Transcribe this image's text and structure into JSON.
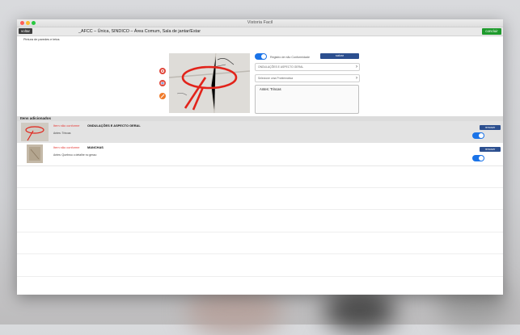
{
  "window": {
    "title": "Vistoria Facil"
  },
  "navbar": {
    "back_label": "voltar",
    "breadcrumb": "_AFCC – Única, SINDICO – Área Comum, Sala de jantar/Estar",
    "finish_label": "concluir"
  },
  "form": {
    "section_title": "Pintura de paredes e tetos",
    "register_label": "Registro de não Conformidade",
    "register_checked": true,
    "save_label": "salvar",
    "select_item_value": "ONDULAÇÕES E ASPECTO GERAL",
    "select_problem_placeholder": "Selecione uma Problemática",
    "notes_value": "Antes: Trincas"
  },
  "items": {
    "header": "Itens adicionados",
    "rows": [
      {
        "status": "Item não conforme",
        "name": "ONDULAÇÕES E ASPECTO GERAL",
        "annotation": "Antes: Trincas",
        "remove_label": "remover",
        "enabled": true
      },
      {
        "status": "Item não conforme",
        "name": "MANCHAS",
        "annotation": "Antes: Quebrou o detalhe no gesso",
        "remove_label": "remover",
        "enabled": true
      }
    ]
  },
  "colors": {
    "accent": "#1a73e8",
    "save": "#2c4f8f",
    "finish": "#1e9a2c",
    "status": "#e53935"
  },
  "icons": [
    "camera-icon",
    "gallery-icon",
    "edit-icon",
    "chevron-right-icon"
  ]
}
